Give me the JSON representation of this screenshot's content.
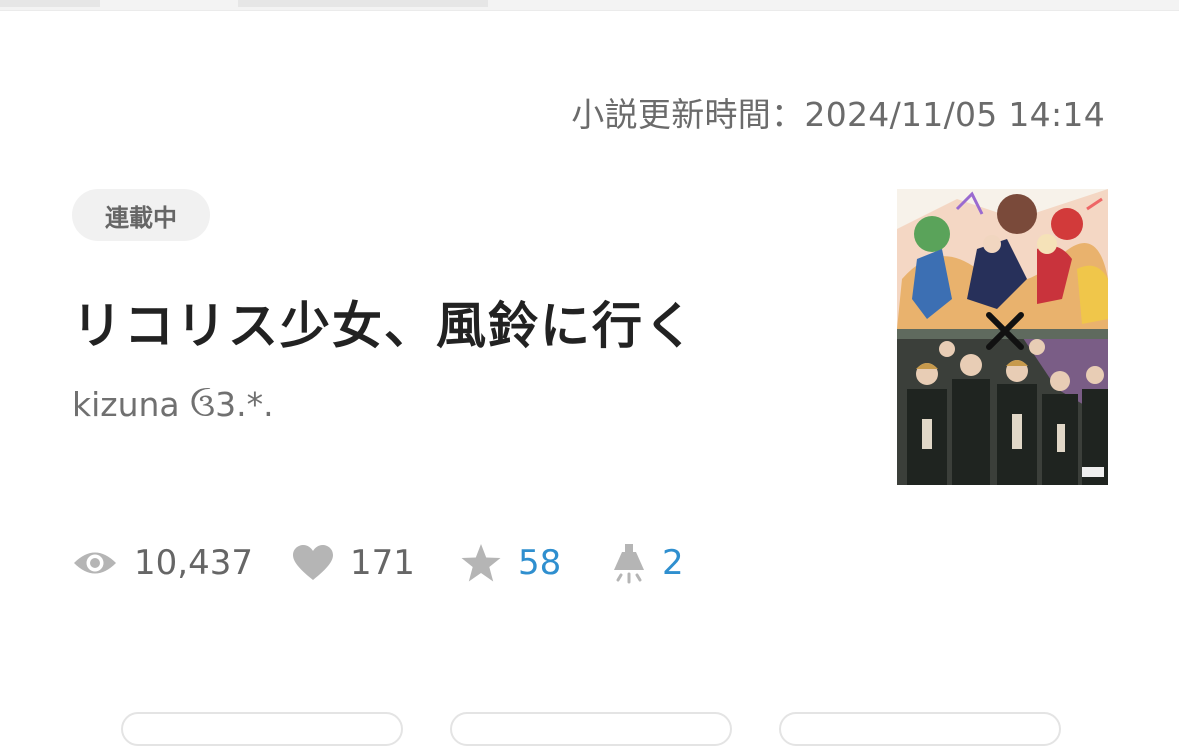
{
  "update": {
    "label": "小説更新時間：2024/11/05 14:14"
  },
  "novel": {
    "status_badge": "連載中",
    "title": "リコリス少女、風鈴に行く",
    "author": "kizuna ઉ3.*."
  },
  "cover": {
    "description_icon": "cover-image",
    "cross_mark": "✕"
  },
  "stats": {
    "views": {
      "icon": "eye-icon",
      "value": "10,437"
    },
    "likes": {
      "icon": "heart-icon",
      "value": "171"
    },
    "stars": {
      "icon": "star-icon",
      "value": "58"
    },
    "lamps": {
      "icon": "lamp-icon",
      "value": "2"
    }
  },
  "colors": {
    "accent_blue": "#2f8fcf",
    "text_gray": "#666666",
    "icon_gray": "#b5b5b5"
  }
}
